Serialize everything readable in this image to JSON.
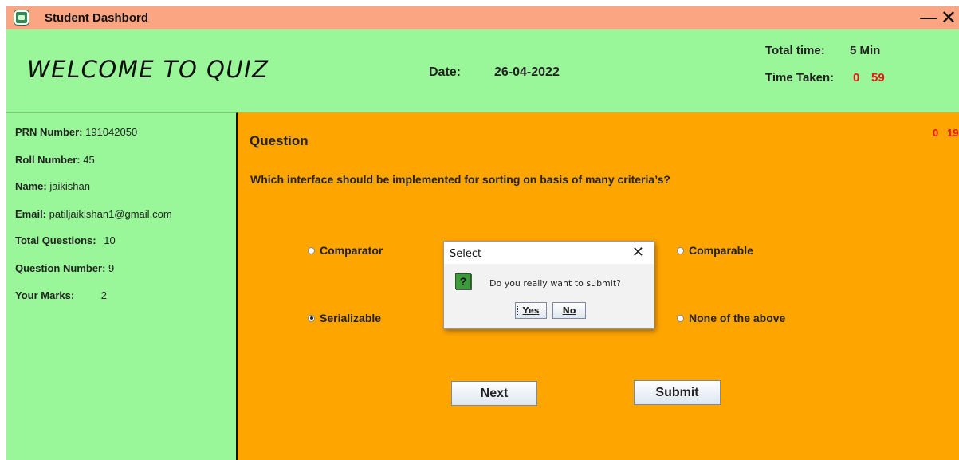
{
  "window": {
    "title": "Student Dashbord",
    "minimize_glyph": "—",
    "close_glyph": "✕"
  },
  "header": {
    "welcome": "WELCOME TO QUIZ",
    "date_label": "Date:",
    "date_value": "26-04-2022",
    "total_time_label": "Total time:",
    "total_time_value": "5 Min",
    "time_taken_label": "Time Taken:",
    "time_taken_minutes": "0",
    "time_taken_seconds": "59"
  },
  "student": {
    "prn_label": "PRN Number:",
    "prn_value": "191042050",
    "roll_label": "Roll Number:",
    "roll_value": "45",
    "name_label": "Name:",
    "name_value": "jaikishan",
    "email_label": "Email:",
    "email_value": "patiljaikishan1@gmail.com",
    "total_q_label": "Total Questions:",
    "total_q_value": "10",
    "q_number_label": "Question Number:",
    "q_number_value": "9",
    "marks_label": "Your Marks:",
    "marks_value": "2"
  },
  "question": {
    "heading": "Question",
    "timer_a": "0",
    "timer_b": "19",
    "text": "Which interface should be implemented for sorting on basis of many criteria’s?",
    "options": [
      {
        "label": "Comparator",
        "selected": false
      },
      {
        "label": "Comparable",
        "selected": false
      },
      {
        "label": "Serializable",
        "selected": true
      },
      {
        "label": "None of the above",
        "selected": false
      }
    ],
    "next_label": "Next",
    "submit_label": "Submit"
  },
  "dialog": {
    "title": "Select",
    "close_glyph": "✕",
    "icon": "question-icon",
    "icon_glyph": "?",
    "message": "Do you really want to submit?",
    "yes_label": "Yes",
    "no_label": "No"
  },
  "colors": {
    "titlebar": "#fca583",
    "header": "#99f799",
    "main": "#ffa500",
    "timer": "#ee1111"
  }
}
